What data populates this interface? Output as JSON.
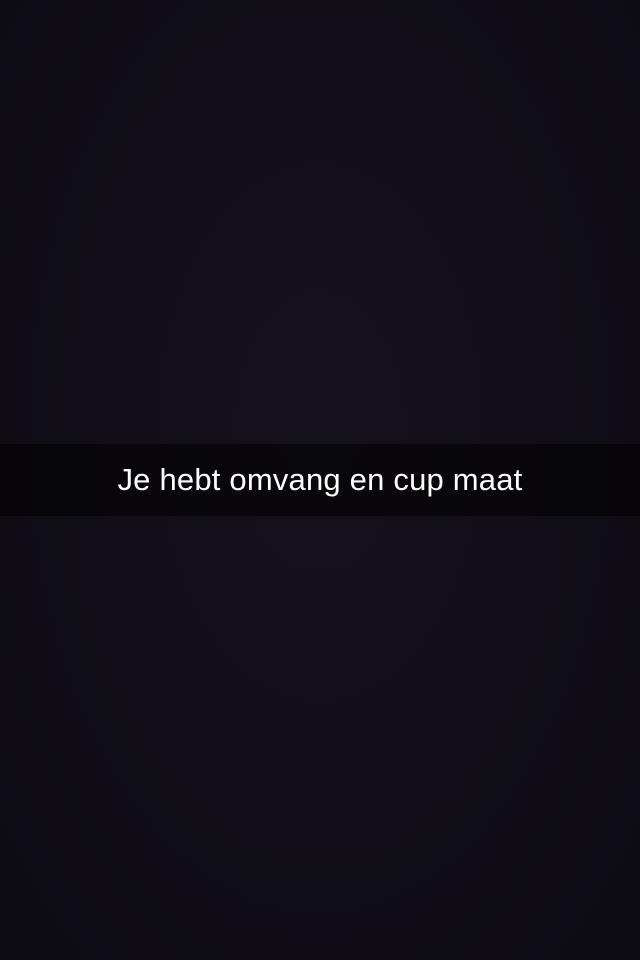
{
  "snap": {
    "caption": "Je hebt omvang en cup maat"
  },
  "colors": {
    "background": "#110e17",
    "caption_bar": "#000000",
    "caption_text": "#ffffff"
  }
}
